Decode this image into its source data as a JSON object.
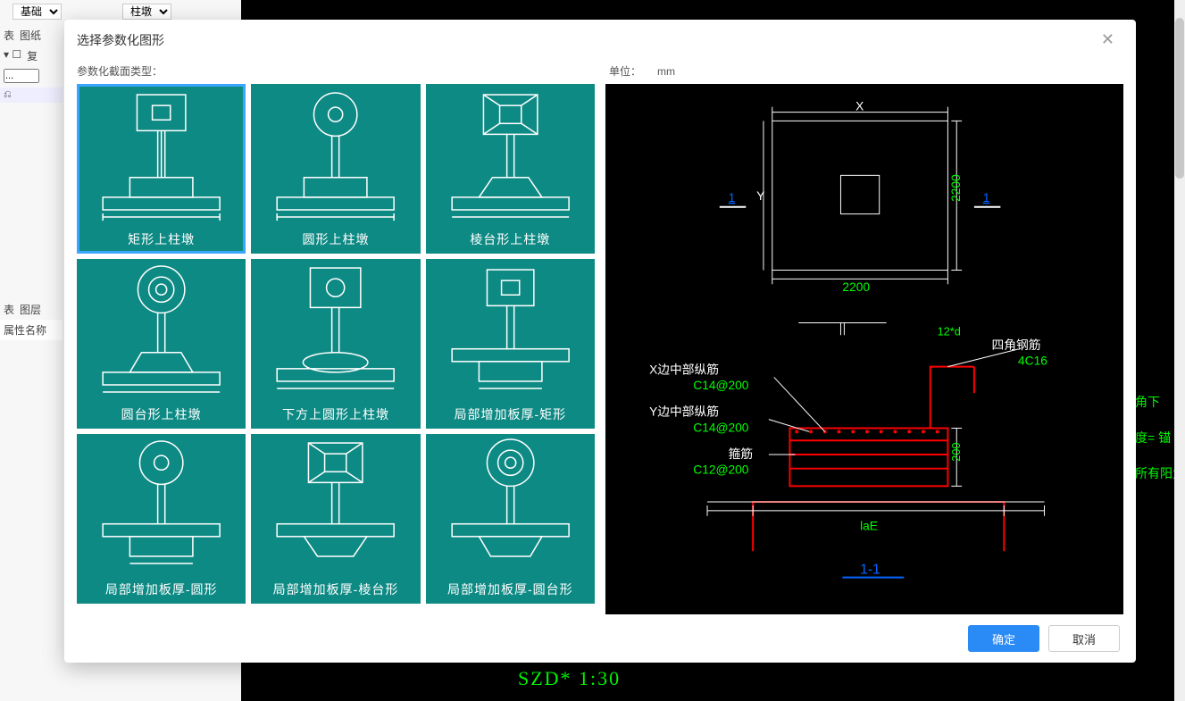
{
  "background": {
    "dropdown1": "基础",
    "dropdown2": "柱墩",
    "side_tabs": [
      "表",
      "图纸",
      "复",
      "图层"
    ],
    "side_input": "...",
    "side_label": "属性名称",
    "bottom_text": "SZD*   1:30",
    "right_text1": "角下",
    "right_text2": "度= 锚",
    "right_text3": "所有阳角"
  },
  "modal": {
    "title": "选择参数化图形",
    "section_label": "参数化截面类型：",
    "unit_label": "单位：",
    "unit_value": "mm",
    "tiles": [
      {
        "label": "矩形上柱墩"
      },
      {
        "label": "圆形上柱墩"
      },
      {
        "label": "棱台形上柱墩"
      },
      {
        "label": "圆台形上柱墩"
      },
      {
        "label": "下方上圆形上柱墩"
      },
      {
        "label": "局部增加板厚-矩形"
      },
      {
        "label": "局部增加板厚-圆形"
      },
      {
        "label": "局部增加板厚-棱台形"
      },
      {
        "label": "局部增加板厚-圆台形"
      }
    ],
    "ok": "确定",
    "cancel": "取消"
  },
  "preview": {
    "top": {
      "x_label": "X",
      "y_label": "Y",
      "dim_h": "2200",
      "dim_v": "2200",
      "sect_left": "1",
      "sect_right": "1"
    },
    "bottom": {
      "x_rebar_label": "X边中部纵筋",
      "x_rebar_value": "C14@200",
      "y_rebar_label": "Y边中部纵筋",
      "y_rebar_value": "C14@200",
      "stirrup_label": "箍筋",
      "stirrup_value": "C12@200",
      "top_note": "12*d",
      "corner_label": "四角钢筋",
      "corner_value": "4C16",
      "height": "200",
      "lae": "laE",
      "section": "1-1"
    }
  }
}
